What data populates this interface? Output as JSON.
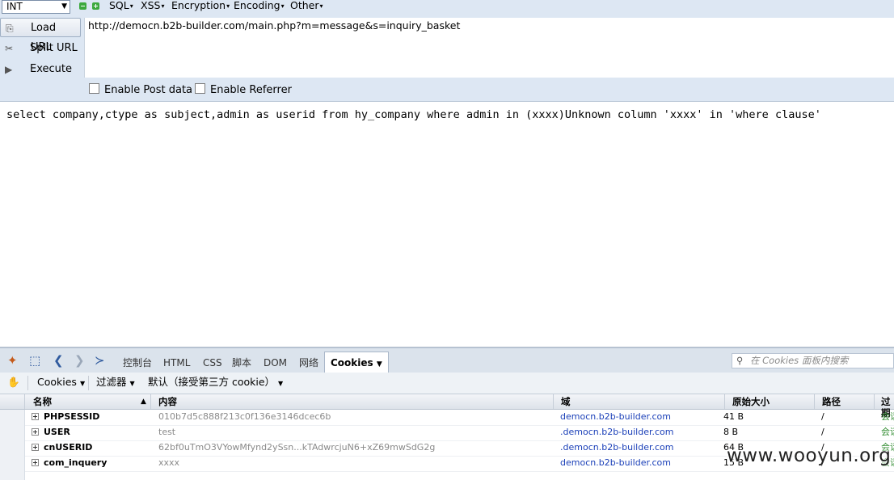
{
  "hackbar": {
    "select_value": "INT",
    "menus": [
      "SQL",
      "XSS",
      "Encryption",
      "Encoding",
      "Other"
    ],
    "buttons": {
      "load": "Load URL",
      "split": "Split URL",
      "execute": "Execute"
    },
    "url": "http://democn.b2b-builder.com/main.php?m=message&s=inquiry_basket",
    "checks": {
      "post": "Enable Post data",
      "referrer": "Enable Referrer"
    }
  },
  "page": {
    "text": "select company,ctype as subject,admin as userid from hy_company where admin in (xxxx)Unknown column 'xxxx' in 'where clause'"
  },
  "firebug": {
    "tabs": [
      "控制台",
      "HTML",
      "CSS",
      "脚本",
      "DOM",
      "网络"
    ],
    "active_tab": "Cookies",
    "search_placeholder": "在 Cookies 面板内搜索",
    "sub": {
      "cookies": "Cookies",
      "filter": "过滤器",
      "default": "默认（接受第三方 cookie）"
    },
    "columns": {
      "name": "名称",
      "content": "内容",
      "domain": "域",
      "size": "原始大小",
      "path": "路径",
      "expires": "过期"
    },
    "rows": [
      {
        "name": "PHPSESSID",
        "value": "010b7d5c888f213c0f136e3146dcec6b",
        "domain": "democn.b2b-builder.com",
        "size": "41 B",
        "path": "/",
        "expires": "会话"
      },
      {
        "name": "USER",
        "value": "test",
        "domain": ".democn.b2b-builder.com",
        "size": "8 B",
        "path": "/",
        "expires": "会话"
      },
      {
        "name": "cnUSERID",
        "value": "62bf0uTmO3VYowMfynd2ySsn...kTAdwrcjuN6+xZ69mwSdG2g",
        "domain": ".democn.b2b-builder.com",
        "size": "64 B",
        "path": "/",
        "expires": "会话"
      },
      {
        "name": "com_inquery",
        "value": "xxxx",
        "domain": "democn.b2b-builder.com",
        "size": "15 B",
        "path": "/",
        "expires": "会话"
      }
    ]
  },
  "watermark": "www.wooyun.org",
  "colors": {
    "toolbar_bg": "#dde7f3",
    "link_blue": "#1a3fb8",
    "session_green": "#2e8b2e"
  }
}
